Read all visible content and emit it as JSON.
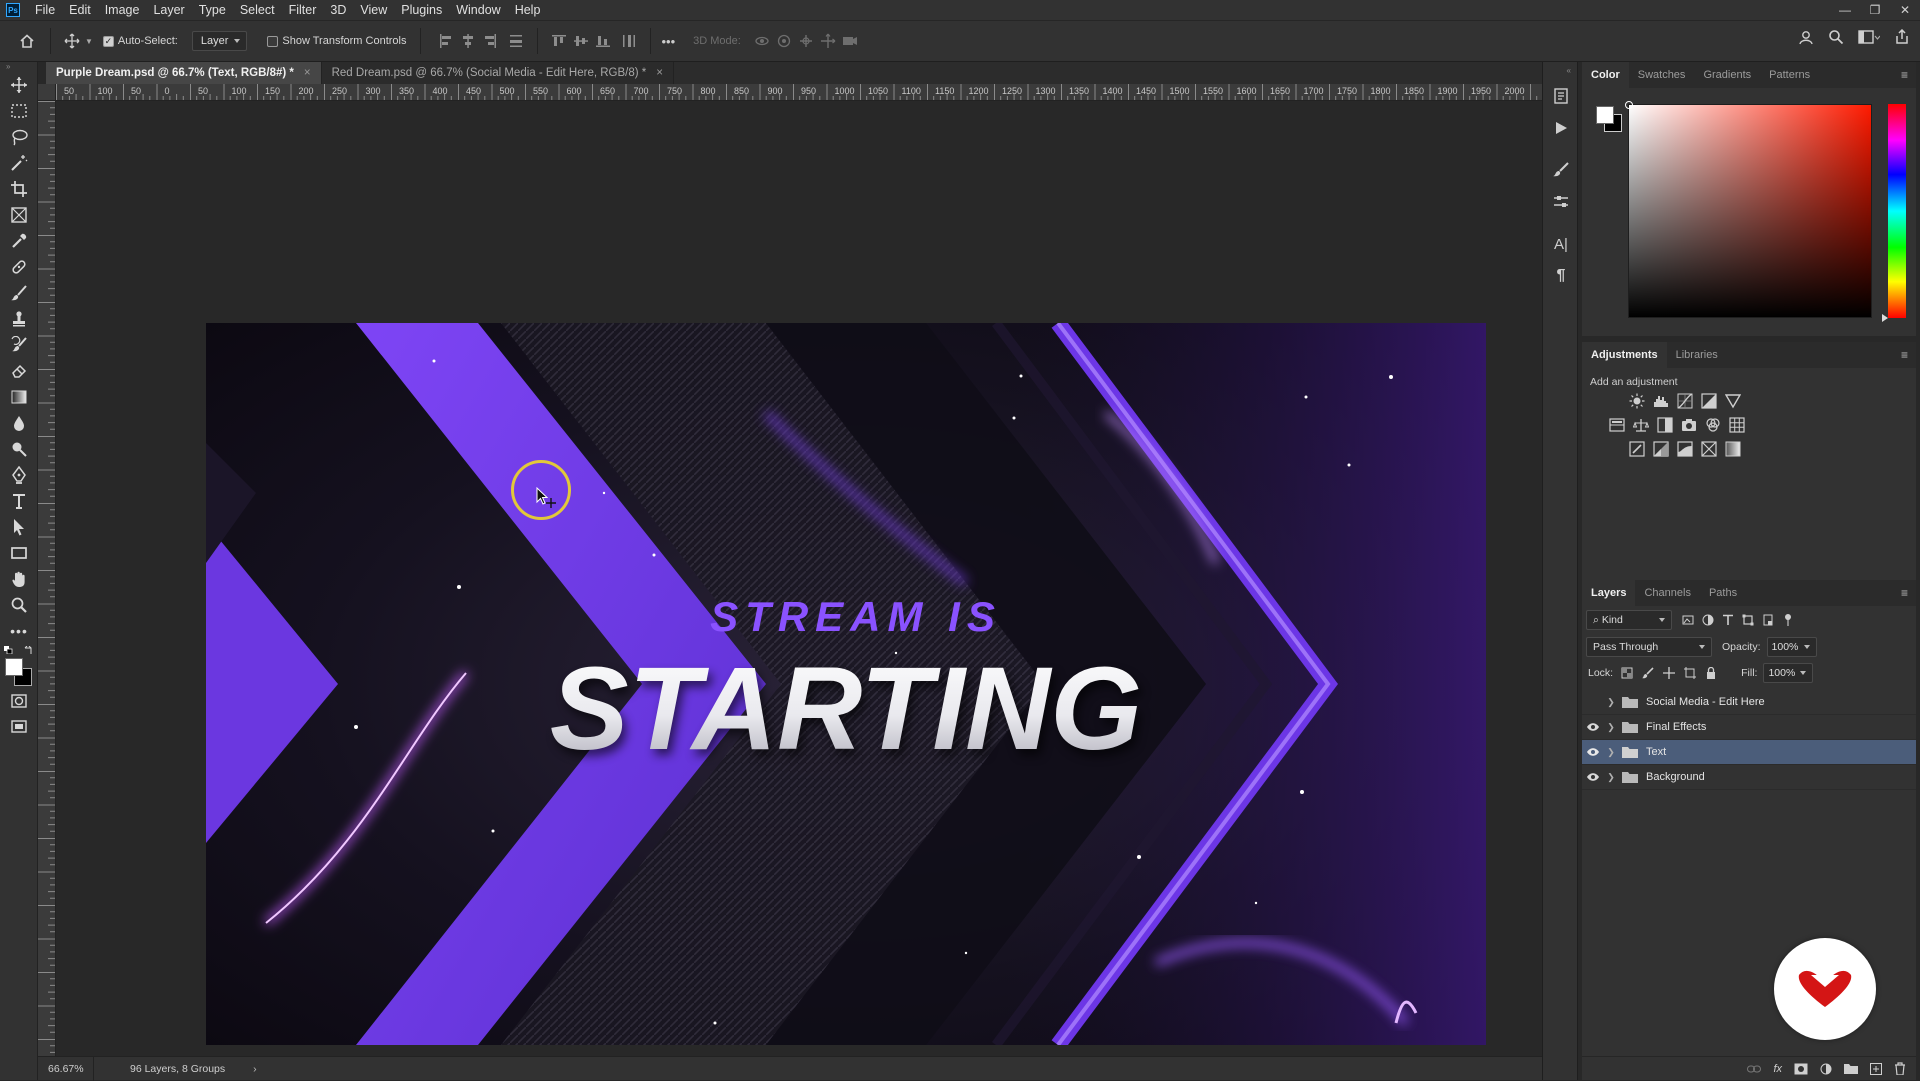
{
  "menubar": {
    "app_logo": "Ps",
    "items": [
      "File",
      "Edit",
      "Image",
      "Layer",
      "Type",
      "Select",
      "Filter",
      "3D",
      "View",
      "Plugins",
      "Window",
      "Help"
    ]
  },
  "options": {
    "auto_select_label": "Auto-Select:",
    "auto_select_checked": true,
    "layer_select_value": "Layer",
    "transform_label": "Show Transform Controls",
    "transform_checked": false,
    "mode_3d_label": "3D Mode:",
    "more_label": "•••"
  },
  "tabs": [
    {
      "label": "Purple Dream.psd @ 66.7% (Text, RGB/8#) *",
      "active": true
    },
    {
      "label": "Red Dream.psd @ 66.7% (Social Media - Edit Here, RGB/8) *",
      "active": false
    }
  ],
  "ruler_h": [
    "50",
    "100",
    "50",
    "0",
    "50",
    "100",
    "150",
    "200",
    "250",
    "300",
    "350",
    "400",
    "450",
    "500",
    "550",
    "600",
    "650",
    "700",
    "750",
    "800",
    "850",
    "900",
    "950",
    "1000",
    "1050",
    "1100",
    "1150",
    "1200",
    "1250",
    "1300",
    "1350",
    "1400",
    "1450",
    "1500",
    "1550",
    "1600",
    "1650",
    "1700",
    "1750",
    "1800",
    "1850",
    "1900",
    "1950",
    "2000"
  ],
  "artwork": {
    "line1": "STREAM IS",
    "line2": "STARTING",
    "accent": "#7a3ff0",
    "line1_color": "#8a52ff"
  },
  "status": {
    "zoom": "66.67%",
    "info": "96 Layers, 8 Groups"
  },
  "color_panel": {
    "tabs": [
      "Color",
      "Swatches",
      "Gradients",
      "Patterns"
    ],
    "foreground": "#ffffff",
    "background": "#000000",
    "hue_color": "#ff1a00"
  },
  "adjustments_panel": {
    "tabs": [
      "Adjustments",
      "Libraries"
    ],
    "hint": "Add an adjustment"
  },
  "layers_panel": {
    "tabs": [
      "Layers",
      "Channels",
      "Paths"
    ],
    "filter_kind": "Kind",
    "blend_mode": "Pass Through",
    "opacity_label": "Opacity:",
    "opacity_value": "100%",
    "lock_label": "Lock:",
    "fill_label": "Fill:",
    "fill_value": "100%",
    "layers": [
      {
        "name": "Social Media - Edit Here",
        "visible": false,
        "selected": false
      },
      {
        "name": "Final Effects",
        "visible": true,
        "selected": false
      },
      {
        "name": "Text",
        "visible": true,
        "selected": true
      },
      {
        "name": "Background",
        "visible": true,
        "selected": false
      }
    ]
  }
}
